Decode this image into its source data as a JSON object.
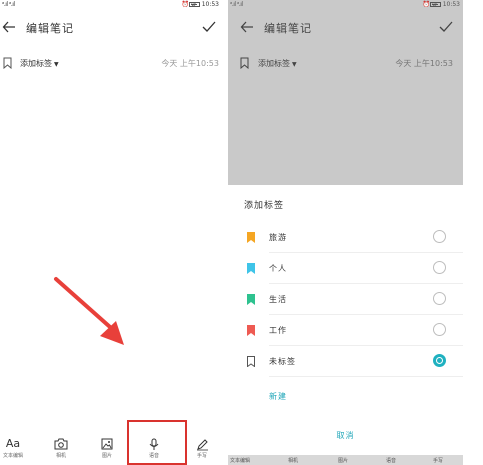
{
  "status_bar": {
    "signal": "ᵃ.ıl ᵃ.ıl",
    "icons": "⏰ ⊘",
    "time": "10:53"
  },
  "header": {
    "title": "编辑笔记"
  },
  "tag_row": {
    "label": "添加标签",
    "caret": "▼",
    "date": "今天 上午10:53"
  },
  "toolbar": {
    "items": [
      {
        "label": "文本编辑",
        "icon": "text-icon",
        "glyph": "Aa"
      },
      {
        "label": "相机",
        "icon": "camera-icon"
      },
      {
        "label": "图片",
        "icon": "image-icon"
      },
      {
        "label": "语音",
        "icon": "microphone-icon"
      },
      {
        "label": "手写",
        "icon": "pen-icon"
      }
    ]
  },
  "tag_sheet": {
    "title": "添加标签",
    "options": [
      {
        "name": "旅游",
        "color": "#f5a623",
        "selected": false
      },
      {
        "name": "个人",
        "color": "#3fc4e8",
        "selected": false
      },
      {
        "name": "生活",
        "color": "#2ec28f",
        "selected": false
      },
      {
        "name": "工作",
        "color": "#ee5a52",
        "selected": false
      },
      {
        "name": "未标签",
        "color": "#ffffff",
        "selected": true
      }
    ],
    "new_label": "新建",
    "cancel_label": "取消"
  },
  "colors": {
    "accent": "#1fb1c0",
    "highlight_box": "#d9332e",
    "arrow": "#e8403a",
    "dim_overlay": "#c9c9c9"
  }
}
